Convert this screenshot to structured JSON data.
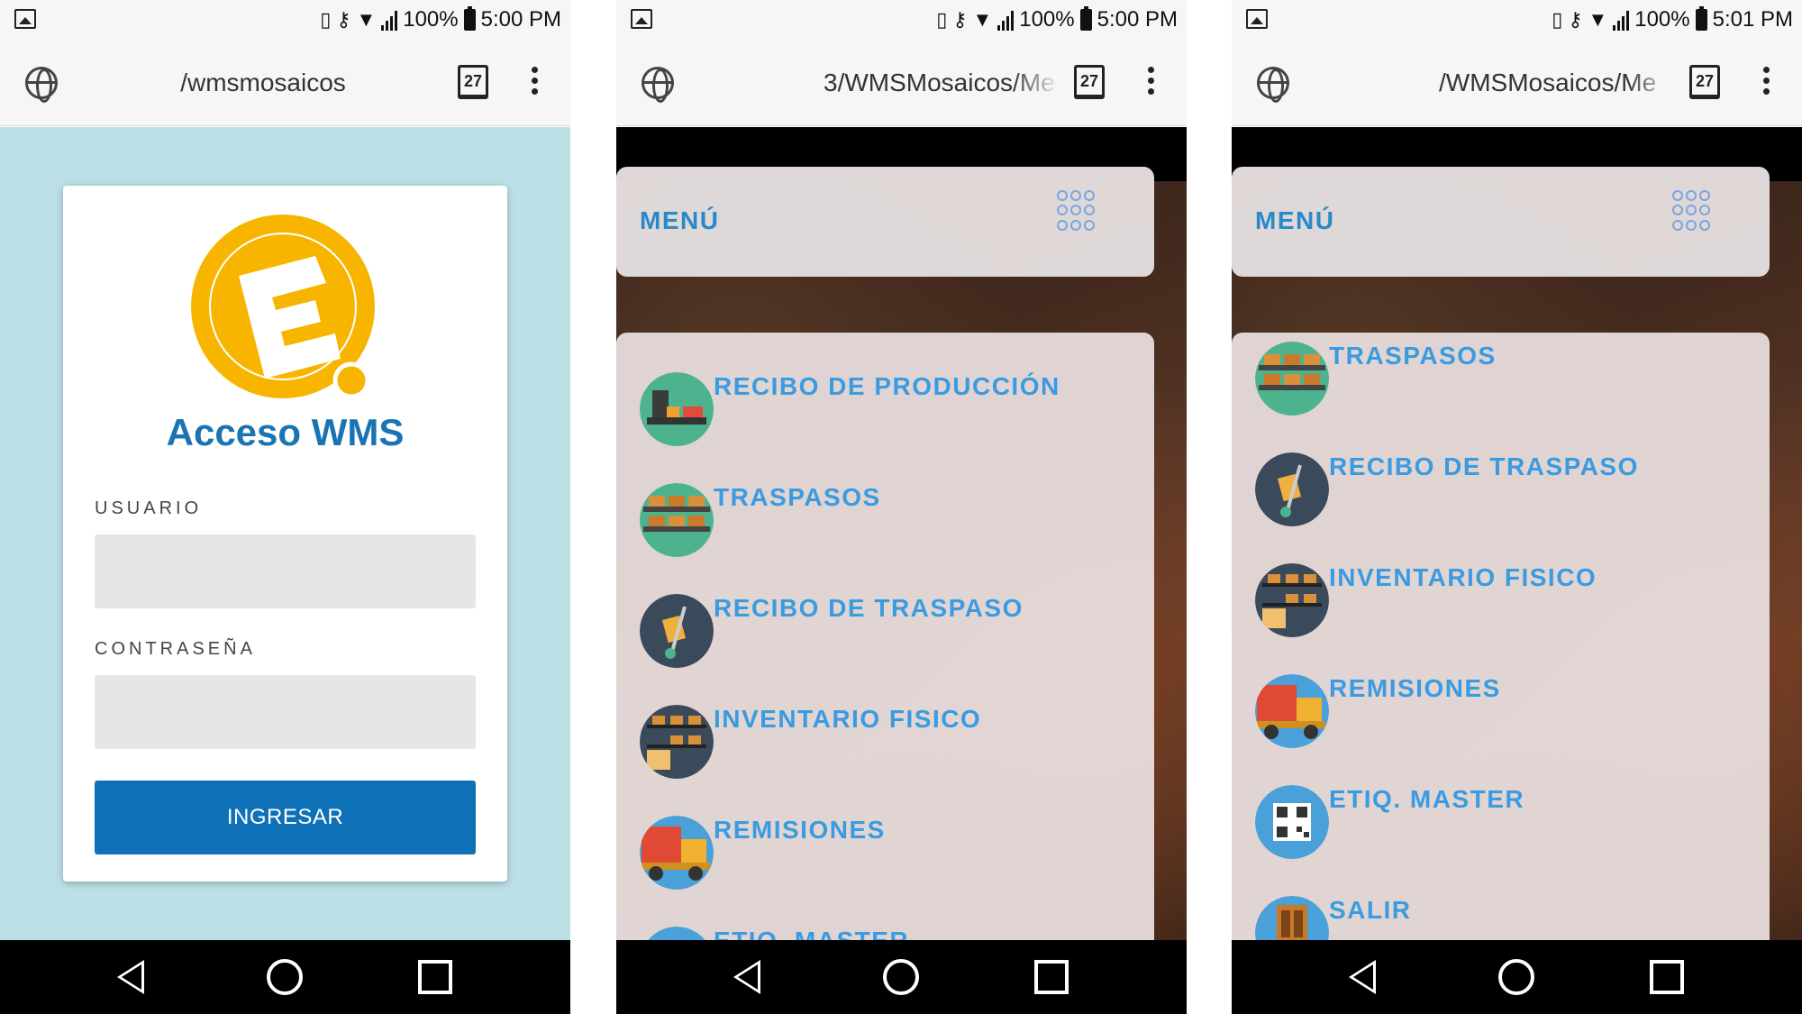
{
  "screens": [
    {
      "status": {
        "battery": "100%",
        "time": "5:00 PM"
      },
      "browser": {
        "url": "/wmsmosaicos",
        "tab_count": "27"
      },
      "login": {
        "title": "Acceso WMS",
        "user_label": "USUARIO",
        "password_label": "CONTRASEÑA",
        "submit": "INGRESAR"
      }
    },
    {
      "status": {
        "battery": "100%",
        "time": "5:00 PM"
      },
      "browser": {
        "url": "3/WMSMosaicos/Me",
        "tab_count": "27"
      },
      "menu": {
        "title": "MENÚ",
        "items": [
          {
            "label": "RECIBO DE PRODUCCIÓN",
            "icon": "production-icon"
          },
          {
            "label": "TRASPASOS",
            "icon": "shelves-icon"
          },
          {
            "label": "RECIBO DE TRASPASO",
            "icon": "hand-truck-icon"
          },
          {
            "label": "INVENTARIO FISICO",
            "icon": "inventory-icon"
          },
          {
            "label": "REMISIONES",
            "icon": "truck-icon"
          },
          {
            "label": "ETIQ. MASTER",
            "icon": "qr-code-icon"
          }
        ]
      }
    },
    {
      "status": {
        "battery": "100%",
        "time": "5:01 PM"
      },
      "browser": {
        "url": "/WMSMosaicos/Me",
        "tab_count": "27"
      },
      "menu": {
        "title": "MENÚ",
        "items": [
          {
            "label": "TRASPASOS",
            "icon": "shelves-icon"
          },
          {
            "label": "RECIBO DE TRASPASO",
            "icon": "hand-truck-icon"
          },
          {
            "label": "INVENTARIO FISICO",
            "icon": "inventory-icon"
          },
          {
            "label": "REMISIONES",
            "icon": "truck-icon"
          },
          {
            "label": "ETIQ. MASTER",
            "icon": "qr-code-icon"
          },
          {
            "label": "SALIR",
            "icon": "door-icon"
          }
        ]
      }
    }
  ],
  "colors": {
    "accent_blue": "#0e71b8",
    "menu_text": "#3a9be0",
    "logo_orange": "#f7b500",
    "login_bg": "#bcdfe6"
  }
}
